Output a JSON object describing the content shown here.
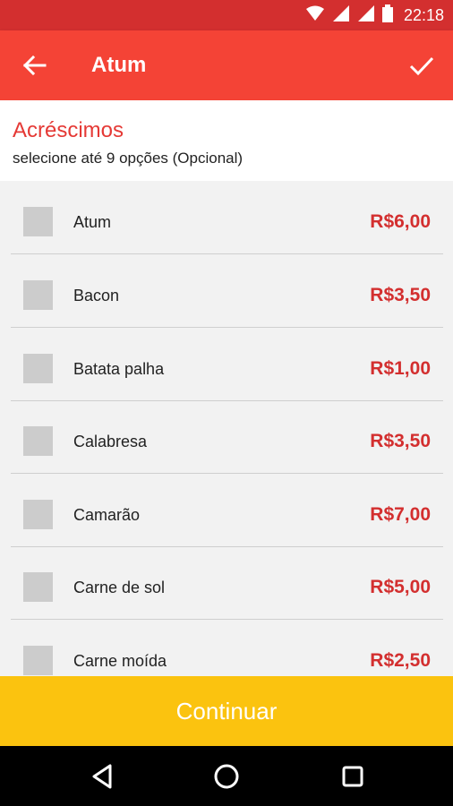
{
  "status_bar": {
    "time": "22:18",
    "icons": [
      "wifi-icon",
      "signal-icon",
      "signal-icon",
      "battery-icon"
    ]
  },
  "app_bar": {
    "title": "Atum",
    "back_icon": "arrow-back-icon",
    "confirm_icon": "check-icon"
  },
  "section": {
    "title": "Acréscimos",
    "subtitle": "selecione até 9 opções (Opcional)"
  },
  "options": [
    {
      "name": "Atum",
      "price": "R$6,00",
      "checked": false
    },
    {
      "name": "Bacon",
      "price": "R$3,50",
      "checked": false
    },
    {
      "name": "Batata palha",
      "price": "R$1,00",
      "checked": false
    },
    {
      "name": "Calabresa",
      "price": "R$3,50",
      "checked": false
    },
    {
      "name": "Camarão",
      "price": "R$7,00",
      "checked": false
    },
    {
      "name": "Carne de sol",
      "price": "R$5,00",
      "checked": false
    },
    {
      "name": "Carne moída",
      "price": "R$2,50",
      "checked": false
    }
  ],
  "continue_button": {
    "label": "Continuar"
  },
  "nav_bar": {
    "icons": [
      "back-triangle-icon",
      "home-circle-icon",
      "recents-square-icon"
    ]
  },
  "colors": {
    "status_bar": "#d32f2f",
    "app_bar": "#f44336",
    "accent_red": "#e53935",
    "price_red": "#d32f2f",
    "continue_yellow": "#fbc30f",
    "checkbox_gray": "#cccccc"
  }
}
